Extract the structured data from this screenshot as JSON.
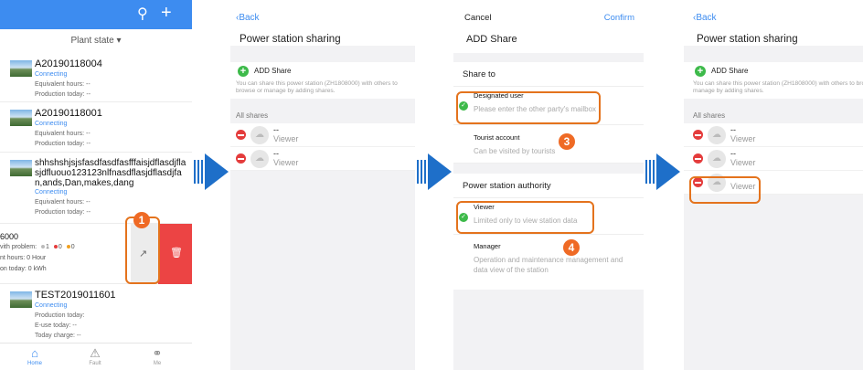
{
  "colors": {
    "accent": "#3d8cf0",
    "delete": "#ec4444",
    "highlight": "#e4731d",
    "step": "#ef6a25",
    "add": "#3dba4a"
  },
  "list_screen": {
    "header": {
      "search_icon": "search-icon",
      "add_icon": "plus-icon"
    },
    "plant_state": "Plant state ▾",
    "plants": [
      {
        "name": "A20190118004",
        "status": "Connecting",
        "line1": "Equivalent hours:  --",
        "line2": "Production today:  --"
      },
      {
        "name": "A20190118001",
        "status": "Connecting",
        "line1": "Equivalent hours:  --",
        "line2": "Production today:  --"
      },
      {
        "name": "shhshshjsjsfasdfasdfasfffaisjdflasdjflasjdfluouo123123nlfnasdflasjdflasdjfan,ands,Dan,makes,dang",
        "status": "Connecting",
        "line1": "Equivalent hours:  --",
        "line2": "Production today:  --"
      }
    ],
    "swiped": {
      "sn": "6000",
      "problem": "vith problem:",
      "c1": "1",
      "c2": "0",
      "c3": "0",
      "hours": "nt hours:  0 Hour",
      "today": "on today:  0 kWh"
    },
    "last_plant": {
      "name": "TEST2019011601",
      "status": "Connecting",
      "line1": "Production today:",
      "line2": "E-use today:  --",
      "line3": "Today charge:  --"
    },
    "tabs": [
      {
        "label": "Home",
        "icon": "home-icon"
      },
      {
        "label": "Fault",
        "icon": "warning-icon"
      },
      {
        "label": "Me",
        "icon": "person-icon"
      }
    ],
    "step": "1"
  },
  "sharing_screen": {
    "back": "‹Back",
    "title": "Power station sharing",
    "add_share": "ADD Share",
    "hint": "You can share this power station (ZH1808000) with others to browse or manage by adding shares.",
    "all_shares": "All shares",
    "shares": [
      {
        "name": "--",
        "role": "Viewer"
      },
      {
        "name": "--",
        "role": "Viewer"
      }
    ]
  },
  "add_share_screen": {
    "cancel": "Cancel",
    "confirm": "Confirm",
    "title": "ADD Share",
    "share_to": "Share to",
    "designated_user": "Designated user",
    "mailbox_placeholder": "Please enter the other party's mailbox",
    "tourist_account": "Tourist account",
    "tourist_desc": "Can be visited by tourists",
    "authority": "Power station authority",
    "viewer": "Viewer",
    "viewer_desc": "Limited only to view station data",
    "manager": "Manager",
    "manager_desc": "Operation and maintenance management and data view of the station",
    "step3": "3",
    "step4": "4"
  },
  "result_screen": {
    "back": "‹Back",
    "title": "Power station sharing",
    "add_share": "ADD Share",
    "hint": "You can share this power station (ZH1808000) with others to browse or manage by adding shares.",
    "all_shares": "All shares",
    "shares": [
      {
        "name": "--",
        "role": "Viewer"
      },
      {
        "name": "--",
        "role": "Viewer"
      },
      {
        "name": "--",
        "role": "Viewer"
      }
    ]
  }
}
